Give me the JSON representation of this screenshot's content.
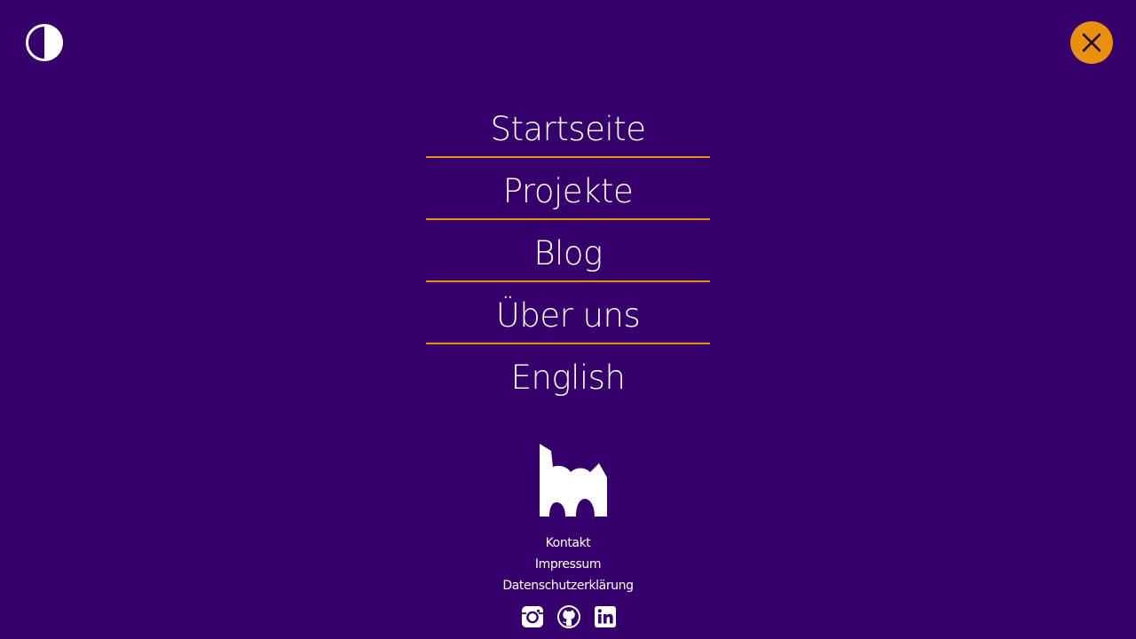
{
  "header": {
    "contrast_icon": "half-circle-contrast-icon",
    "close_icon": "close-x-icon"
  },
  "nav": {
    "items": [
      {
        "label": "Startseite"
      },
      {
        "label": "Projekte"
      },
      {
        "label": "Blog"
      },
      {
        "label": "Über uns"
      },
      {
        "label": "English"
      }
    ]
  },
  "footer": {
    "logo_icon": "brand-logo-icon",
    "links": [
      {
        "label": "Kontakt"
      },
      {
        "label": "Impressum"
      },
      {
        "label": "Datenschutzerklärung"
      }
    ],
    "social": [
      {
        "icon": "instagram-icon"
      },
      {
        "icon": "github-icon"
      },
      {
        "icon": "linkedin-icon"
      }
    ]
  },
  "colors": {
    "background": "#35006b",
    "accent": "#e8910f",
    "text": "#ffffff"
  }
}
